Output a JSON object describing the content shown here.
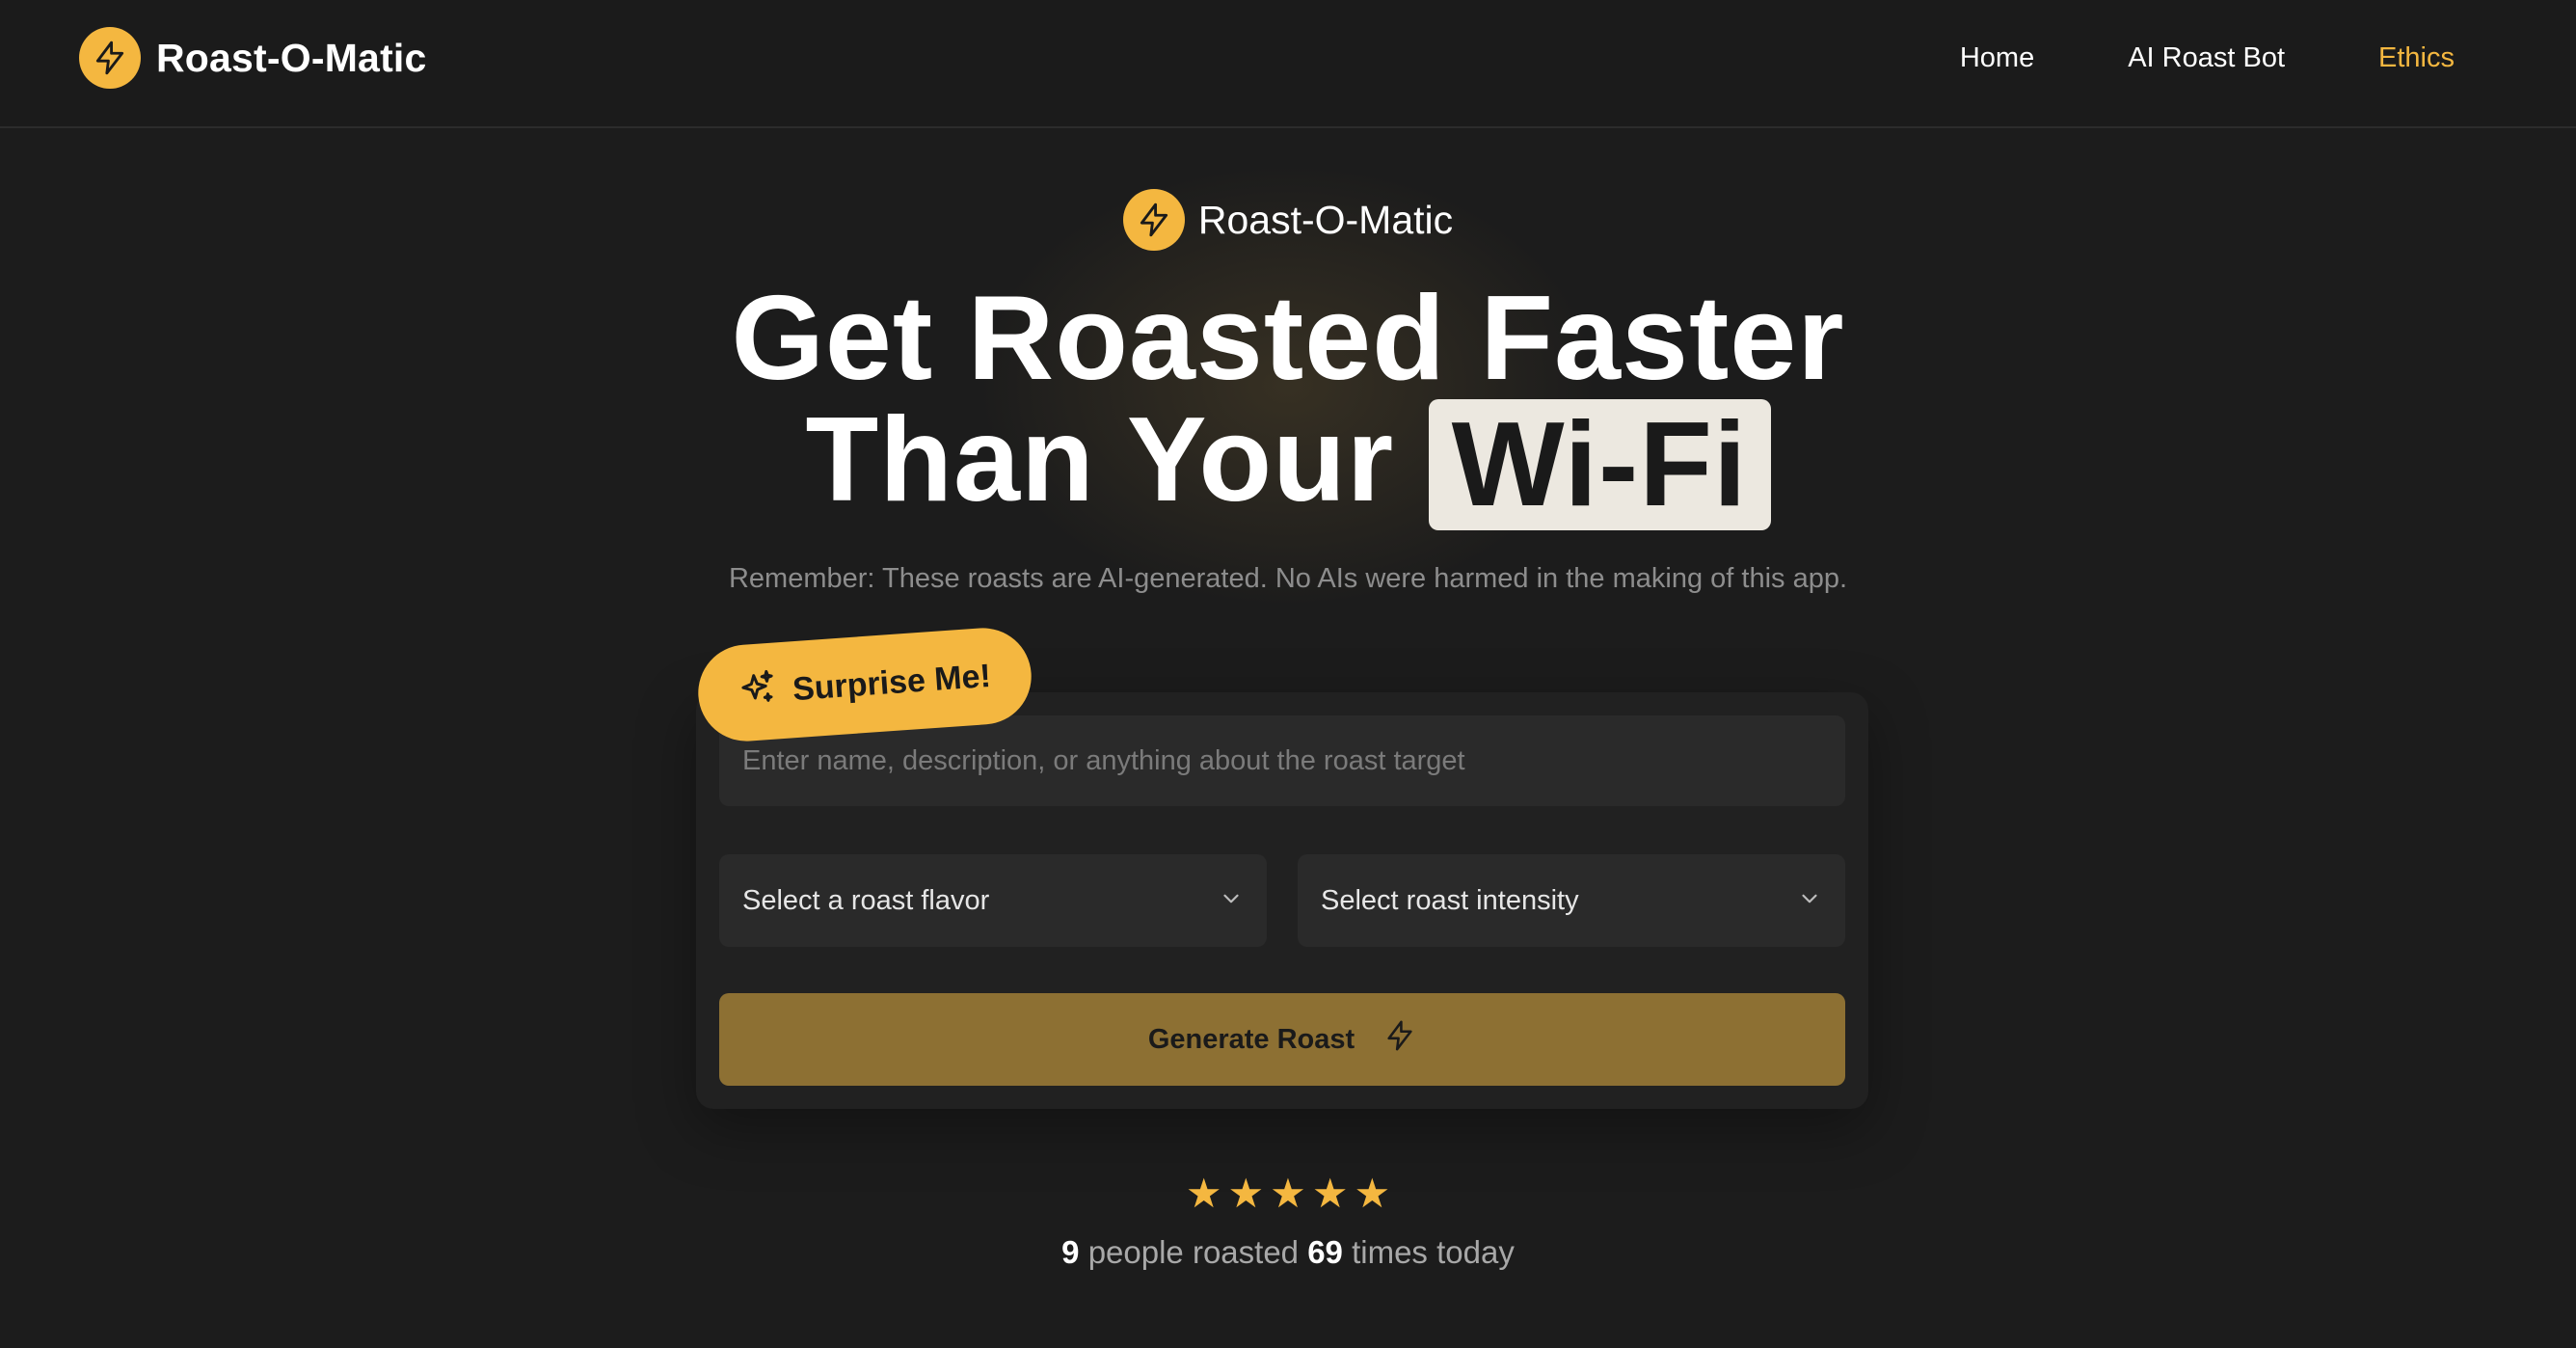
{
  "brand": {
    "name": "Roast-O-Matic",
    "icon": "lightning-bolt-icon",
    "accent": "#f4b740"
  },
  "nav": {
    "links": [
      {
        "label": "Home",
        "active": false
      },
      {
        "label": "AI Roast Bot",
        "active": false
      },
      {
        "label": "Ethics",
        "active": true
      }
    ]
  },
  "hero": {
    "brand_name": "Roast-O-Matic",
    "headline_line1": "Get Roasted Faster",
    "headline_line2_prefix": "Than Your",
    "headline_highlight": "Wi-Fi",
    "disclaimer": "Remember: These roasts are AI-generated. No AIs were harmed in the making of this app."
  },
  "form": {
    "surprise_label": "Surprise Me!",
    "target_placeholder": "Enter name, description, or anything about the roast target",
    "target_value": "",
    "flavor_placeholder": "Select a roast flavor",
    "intensity_placeholder": "Select roast intensity",
    "generate_label": "Generate Roast"
  },
  "stats": {
    "rating_stars": 5,
    "people_count": "9",
    "people_text": "people roasted",
    "roast_count": "69",
    "roast_text": "times today"
  },
  "colors": {
    "background": "#1c1c1c",
    "card": "#212121",
    "input": "#2a2a2a",
    "generate_button": "#8d7033",
    "highlight_bg": "#ece8e0"
  }
}
